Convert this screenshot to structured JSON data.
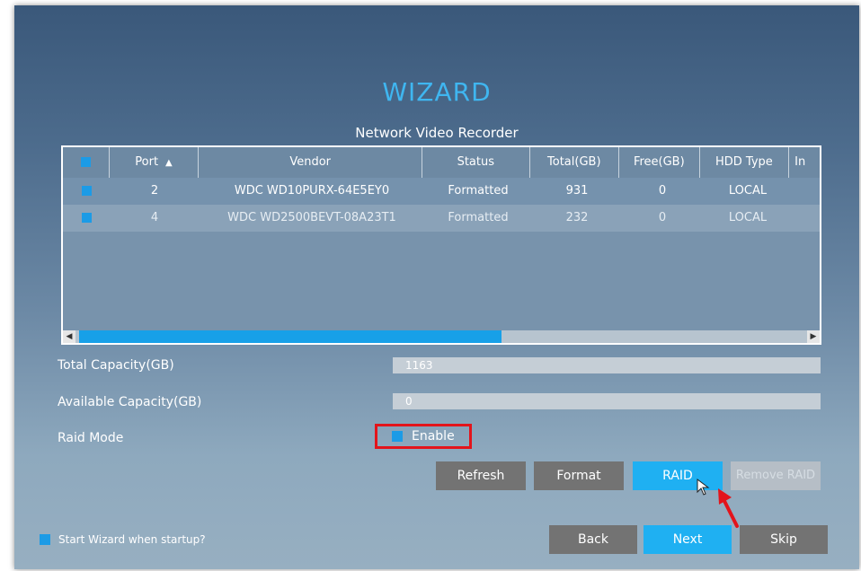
{
  "wizard": {
    "title": "WIZARD",
    "subtitle": "Network Video Recorder"
  },
  "table": {
    "columns": [
      "Port",
      "Vendor",
      "Status",
      "Total(GB)",
      "Free(GB)",
      "HDD Type",
      "In"
    ],
    "rows": [
      {
        "port": "2",
        "vendor": "WDC WD10PURX-64E5EY0",
        "status": "Formatted",
        "total": "931",
        "free": "0",
        "type": "LOCAL"
      },
      {
        "port": "4",
        "vendor": "WDC WD2500BEVT-08A23T1",
        "status": "Formatted",
        "total": "232",
        "free": "0",
        "type": "LOCAL"
      }
    ]
  },
  "capacity": {
    "total_label": "Total Capacity(GB)",
    "total_value": "1163",
    "available_label": "Available Capacity(GB)",
    "available_value": "0"
  },
  "raid": {
    "mode_label": "Raid Mode",
    "enable_label": "Enable"
  },
  "actions": {
    "refresh": "Refresh",
    "format": "Format",
    "raid": "RAID",
    "remove_raid": "Remove RAID"
  },
  "footer": {
    "startup_label": "Start Wizard when startup?",
    "back": "Back",
    "next": "Next",
    "skip": "Skip"
  },
  "colors": {
    "accent": "#1fb0f2",
    "highlight": "#e3141b"
  },
  "icons": [
    "sort-up-icon",
    "scroll-left-icon",
    "scroll-right-icon",
    "cursor-icon",
    "red-arrow-icon"
  ]
}
